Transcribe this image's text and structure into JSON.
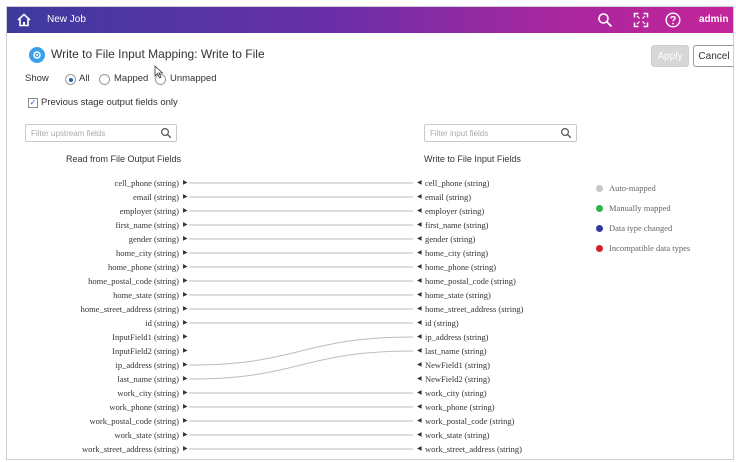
{
  "topbar": {
    "job_title": "New Job",
    "user": "admin",
    "gradient": [
      "#3d3a9e",
      "#c4259a"
    ]
  },
  "dialog": {
    "title": "Write to File Input Mapping: Write to File",
    "apply_label": "Apply",
    "cancel_label": "Cancel"
  },
  "show": {
    "label": "Show",
    "options": [
      "All",
      "Mapped",
      "Unmapped"
    ],
    "selected": "All"
  },
  "previous_stage": {
    "label": "Previous stage output fields only",
    "checked": true
  },
  "left": {
    "filter_placeholder": "Filter upstream fields",
    "header": "Read from File Output Fields",
    "fields": [
      "cell_phone (string)",
      "email (string)",
      "employer (string)",
      "first_name (string)",
      "gender (string)",
      "home_city (string)",
      "home_phone (string)",
      "home_postal_code (string)",
      "home_state (string)",
      "home_street_address (string)",
      "id (string)",
      "InputField1 (string)",
      "InputField2 (string)",
      "ip_address (string)",
      "last_name (string)",
      "work_city (string)",
      "work_phone (string)",
      "work_postal_code (string)",
      "work_state (string)",
      "work_street_address (string)"
    ]
  },
  "right": {
    "filter_placeholder": "Filter input fields",
    "header": "Write to File Input Fields",
    "fields": [
      "cell_phone (string)",
      "email (string)",
      "employer (string)",
      "first_name (string)",
      "gender (string)",
      "home_city (string)",
      "home_phone (string)",
      "home_postal_code (string)",
      "home_state (string)",
      "home_street_address (string)",
      "id (string)",
      "ip_address (string)",
      "last_name (string)",
      "NewField1 (string)",
      "NewField2 (string)",
      "work_city (string)",
      "work_phone (string)",
      "work_postal_code (string)",
      "work_state (string)",
      "work_street_address (string)"
    ]
  },
  "mappings": [
    [
      0,
      0
    ],
    [
      1,
      1
    ],
    [
      2,
      2
    ],
    [
      3,
      3
    ],
    [
      4,
      4
    ],
    [
      5,
      5
    ],
    [
      6,
      6
    ],
    [
      7,
      7
    ],
    [
      8,
      8
    ],
    [
      9,
      9
    ],
    [
      10,
      10
    ],
    [
      13,
      11
    ],
    [
      14,
      12
    ],
    [
      15,
      15
    ],
    [
      16,
      16
    ],
    [
      17,
      17
    ],
    [
      18,
      18
    ],
    [
      19,
      19
    ]
  ],
  "legend": [
    {
      "label": "Auto-mapped",
      "color": "#c8c8c8"
    },
    {
      "label": "Manually mapped",
      "color": "#2bb34a"
    },
    {
      "label": "Data type changed",
      "color": "#2f3a9a"
    },
    {
      "label": "Incompatible data types",
      "color": "#d41f2a"
    }
  ],
  "icons": [
    "home-icon",
    "search-icon",
    "fullscreen-icon",
    "help-icon",
    "settings-icon",
    "cursor-icon"
  ]
}
